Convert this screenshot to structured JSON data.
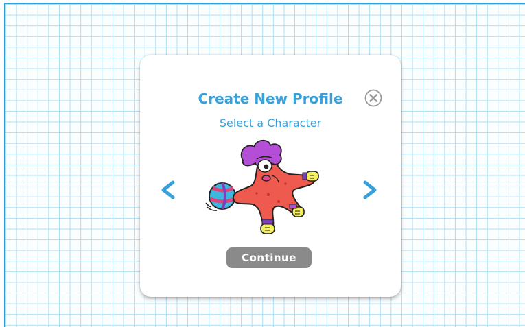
{
  "dialog": {
    "title": "Create New Profile",
    "subtitle": "Select a Character",
    "continue_label": "Continue",
    "close_icon": "close-icon",
    "prev_icon": "chevron-left-icon",
    "next_icon": "chevron-right-icon",
    "character_image": "starfish-character"
  },
  "colors": {
    "accent": "#3aa0da",
    "grid_line": "#a9dff2",
    "border": "#2f9fd4",
    "button": "#8a8a8a",
    "close_gray": "#9a9a9a"
  }
}
